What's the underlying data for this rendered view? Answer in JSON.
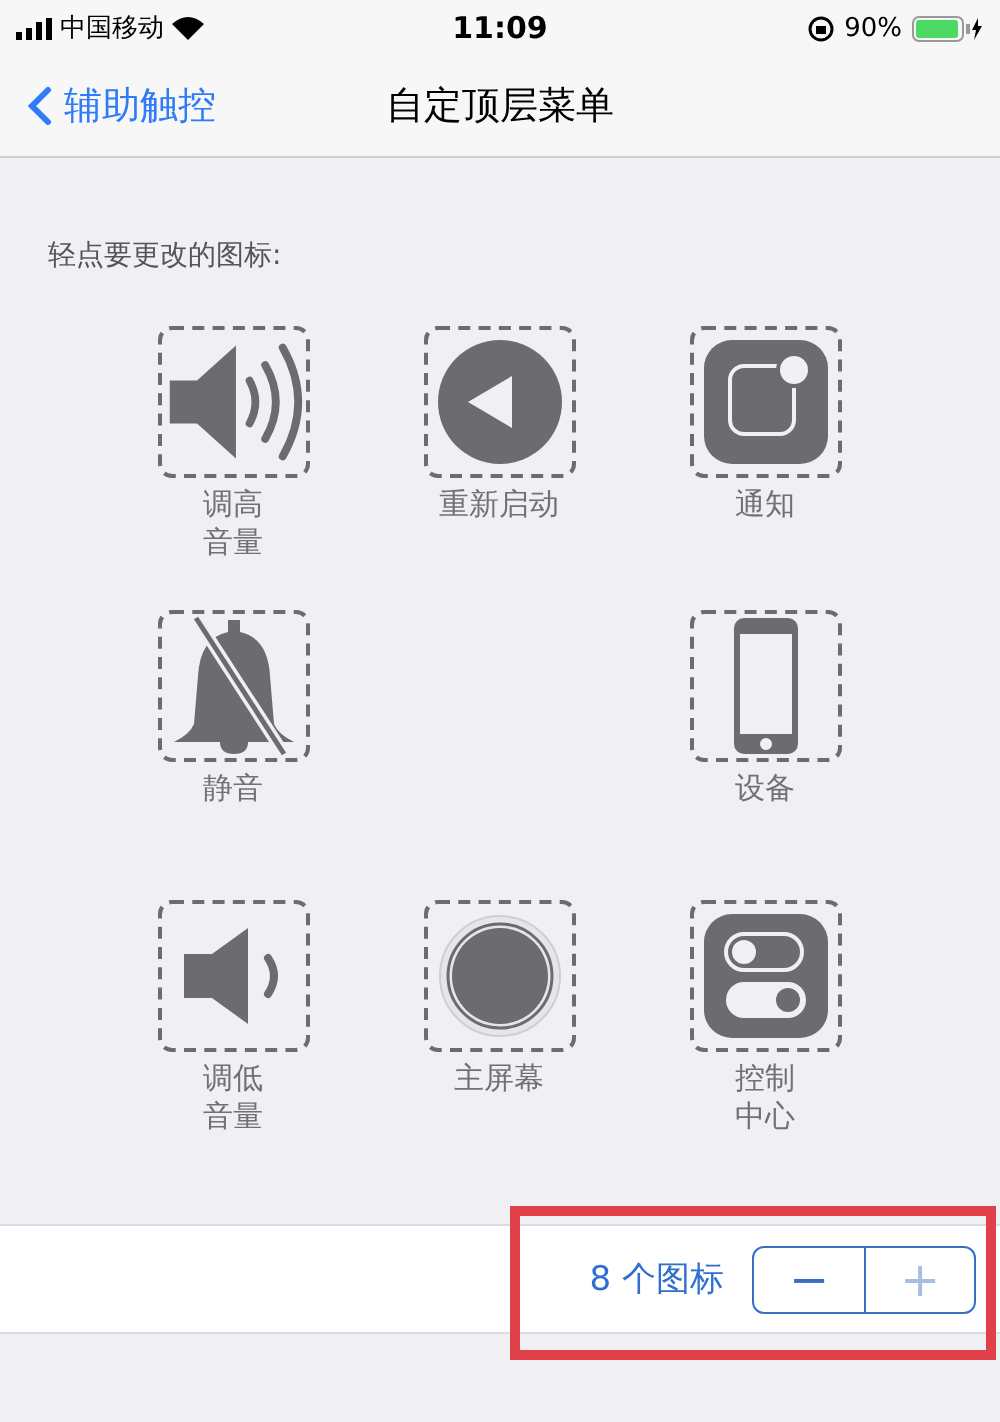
{
  "status_bar": {
    "carrier": "中国移动",
    "time": "11:09",
    "battery": "90%"
  },
  "nav": {
    "back": "辅助触控",
    "title": "自定顶层菜单"
  },
  "instruction": "轻点要更改的图标:",
  "icons": [
    {
      "kind": "volume-up",
      "label": "调高音量"
    },
    {
      "kind": "restart",
      "label": "重新启动"
    },
    {
      "kind": "notification",
      "label": "通知"
    },
    {
      "kind": "mute",
      "label": "静音"
    },
    {
      "kind": "empty"
    },
    {
      "kind": "device",
      "label": "设备"
    },
    {
      "kind": "volume-down",
      "label": "调低音量"
    },
    {
      "kind": "home",
      "label": "主屏幕"
    },
    {
      "kind": "control",
      "label": "控制中心"
    }
  ],
  "count": {
    "text": "8 个图标",
    "minus": {
      "label": "−",
      "disabled": false
    },
    "plus": {
      "label": "+",
      "disabled": true
    }
  }
}
